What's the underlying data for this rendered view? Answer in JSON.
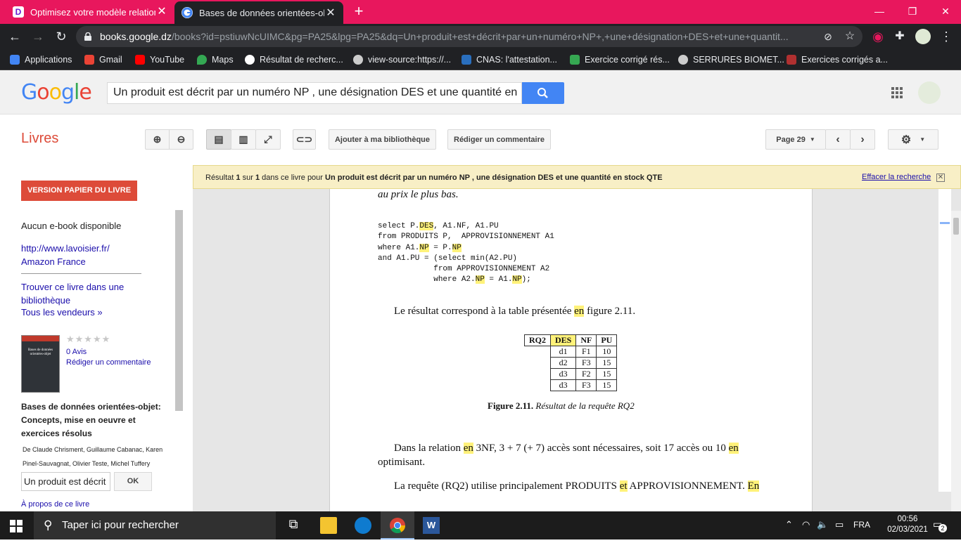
{
  "browser": {
    "tabs": [
      {
        "title": "Optimisez votre modèle relationnel"
      },
      {
        "title": "Bases de données orientées-objet"
      }
    ],
    "new_tab": "+",
    "url_host": "books.google.dz",
    "url_path": "/books?id=pstiuwNcUIMC&pg=PA25&lpg=PA25&dq=Un+produit+est+décrit+par+un+numéro+NP+,+une+désignation+DES+et+une+quantit...",
    "bookmarks": [
      {
        "label": "Applications",
        "color": "#4285f4"
      },
      {
        "label": "Gmail",
        "color": "#ea4335"
      },
      {
        "label": "YouTube",
        "color": "#ff0000"
      },
      {
        "label": "Maps",
        "color": "#34a853"
      },
      {
        "label": "Résultat de recherc...",
        "color": "#ffffff"
      },
      {
        "label": "view-source:https://...",
        "color": "#cccccc"
      },
      {
        "label": "CNAS: l'attestation...",
        "color": "#2a6fbe"
      },
      {
        "label": "Exercice corrigé rés...",
        "color": "#36a852"
      },
      {
        "label": "SERRURES BIOMET...",
        "color": "#cccccc"
      },
      {
        "label": "Exercices corrigés a...",
        "color": "#b03030"
      }
    ]
  },
  "google": {
    "logo": [
      "G",
      "o",
      "o",
      "g",
      "l",
      "e"
    ],
    "search_value": "Un produit est décrit par un numéro NP , une désignation DES et une quantité en"
  },
  "books": {
    "section_title": "Livres",
    "add_library": "Ajouter à ma bibliothèque",
    "write_review": "Rédiger un commentaire",
    "page_label": "Page 29"
  },
  "left_panel": {
    "version_button": "VERSION PAPIER DU LIVRE",
    "no_ebook": "Aucun e-book disponible",
    "links": [
      "http://www.lavoisier.fr/",
      "Amazon France"
    ],
    "find_library": "Trouver ce livre dans une bibliothèque",
    "all_sellers": "Tous les vendeurs »",
    "reviews_count": "0 Avis",
    "write_review": "Rédiger un commentaire",
    "book_title": "Bases de données orientées-objet: Concepts, mise en oeuvre et exercices résolus",
    "authors": "De Claude Chrisment, Guillaume Cabanac, Karen Pinel-Sauvagnat, Olivier Teste, Michel Tuffery",
    "search_value": "Un produit est décrit",
    "ok": "OK",
    "about": "À propos de ce livre",
    "cover_title": "Bases de données orientées-objet",
    "stars": "★★★★★"
  },
  "banner": {
    "prefix": "Résultat ",
    "num": "1",
    "mid": " sur ",
    "total": "1",
    "suffix": " dans ce livre pour ",
    "query": "Un produit est décrit par un numéro NP , une désignation DES et une quantité en stock QTE",
    "clear": "Effacer la recherche"
  },
  "page": {
    "top_line": "au prix le plus bas.",
    "code": [
      "select P.",
      "DES",
      ", A1.NF, A1.PU",
      "from PRODUITS P,  APPROVISIONNEMENT A1",
      "where A1.",
      "NP",
      " = P.",
      "NP",
      "and A1.PU = (select min(A2.PU)",
      "            from APPROVISIONNEMENT A2",
      "            where A2.",
      "NP",
      " = A1.",
      "NP",
      ");"
    ],
    "result_text_a": "Le résultat correspond à la table présentée ",
    "result_text_hl": "en",
    "result_text_b": " figure 2.11.",
    "table_header": [
      "RQ2",
      "DES",
      "NF",
      "PU"
    ],
    "table_rows": [
      [
        "d1",
        "F1",
        "10"
      ],
      [
        "d2",
        "F3",
        "15"
      ],
      [
        "d3",
        "F2",
        "15"
      ],
      [
        "d3",
        "F3",
        "15"
      ]
    ],
    "caption_bold": "Figure 2.11.",
    "caption_italic": " Résultat de la requête RQ2",
    "para1_a": "Dans la relation ",
    "para1_hl1": "en",
    "para1_b": " 3NF, 3 + 7 (+ 7) accès sont nécessaires, soit 17 accès ou 10 ",
    "para1_hl2": "en",
    "para1_c": "optimisant.",
    "para2_a": "La requête (RQ2) utilise principalement PRODUITS ",
    "para2_hl": "et",
    "para2_b": " APPROVISIONNEMENT. ",
    "para2_hl2": "En"
  },
  "taskbar": {
    "search_placeholder": "Taper ici pour rechercher",
    "lang": "FRA",
    "time": "00:56",
    "date": "02/03/2021",
    "notif_count": "2"
  }
}
